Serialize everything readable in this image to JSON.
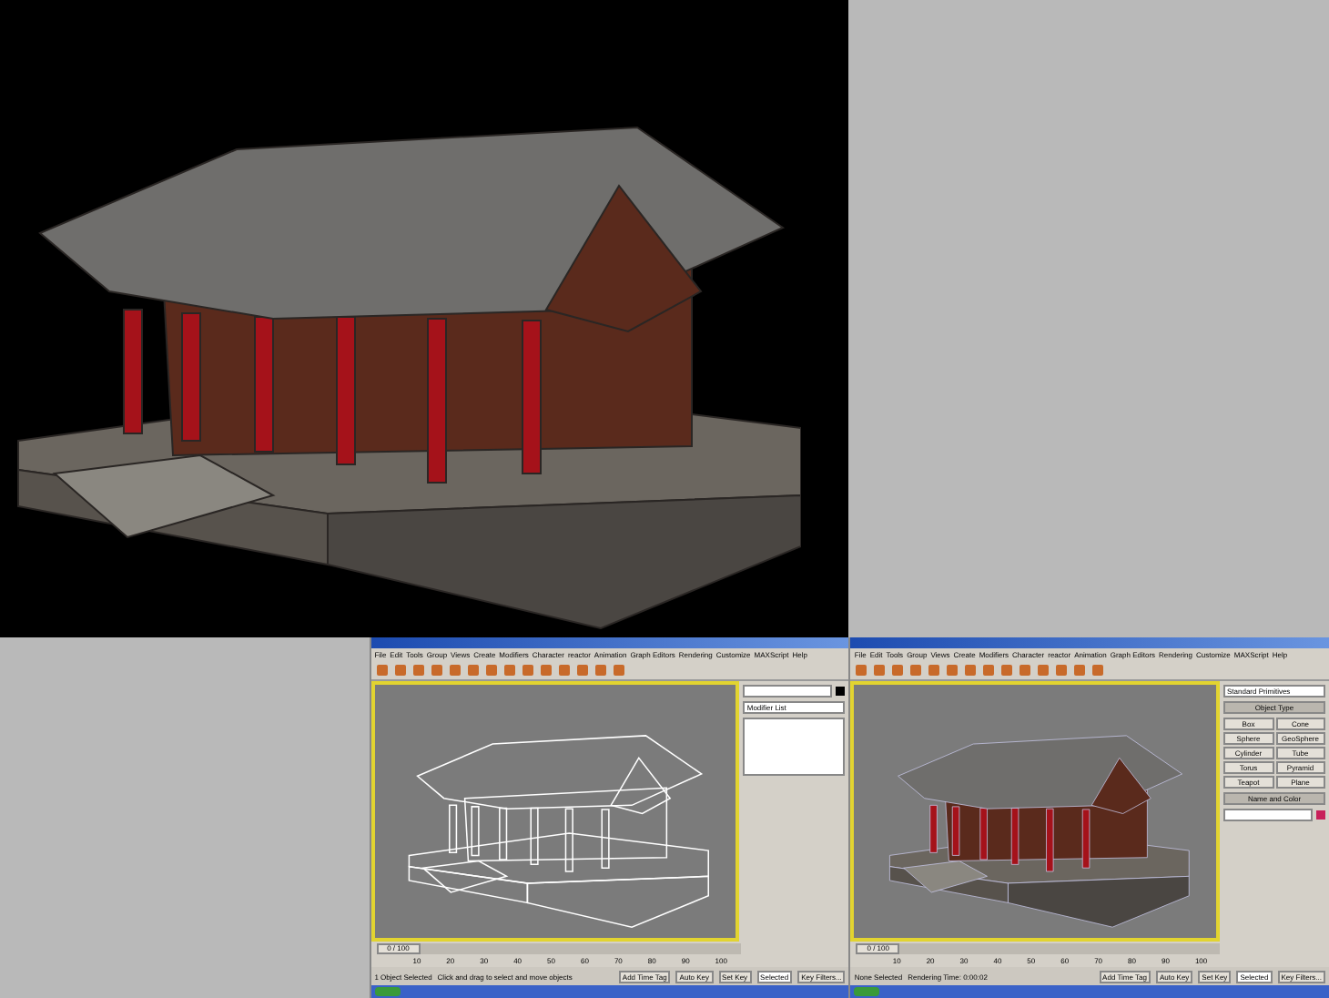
{
  "screenshots": [
    {
      "viewport": {
        "kind": "wireframe"
      },
      "menus": [
        "File",
        "Edit",
        "Tools",
        "Group",
        "Views",
        "Create",
        "Modifiers",
        "Character",
        "reactor",
        "Animation",
        "Graph Editors",
        "Rendering",
        "Customize",
        "MAXScript",
        "Help"
      ],
      "panel": {
        "kind": "modify",
        "dropdown": "Modifier List"
      },
      "timeline": {
        "position": "0 / 100",
        "level": 0,
        "ticks": [
          "10",
          "20",
          "30",
          "40",
          "50",
          "60",
          "70",
          "80",
          "90",
          "100"
        ]
      },
      "status": {
        "selection": "1 Object Selected",
        "prompt": "Click and drag to select and move objects",
        "auto_key": "Auto Key",
        "set_key": "Set Key",
        "key_mode": "Selected",
        "key_filters": "Key Filters...",
        "time_tag": "Add Time Tag"
      }
    },
    {
      "viewport": {
        "kind": "shaded"
      },
      "menus": [
        "File",
        "Edit",
        "Tools",
        "Group",
        "Views",
        "Create",
        "Modifiers",
        "Character",
        "reactor",
        "Animation",
        "Graph Editors",
        "Rendering",
        "Customize",
        "MAXScript",
        "Help"
      ],
      "panel": {
        "kind": "create",
        "dropdown": "Standard Primitives",
        "section": "Object Type",
        "buttons": [
          "Box",
          "Cone",
          "Sphere",
          "GeoSphere",
          "Cylinder",
          "Tube",
          "Torus",
          "Pyramid",
          "Teapot",
          "Plane"
        ],
        "section_2": "Name and Color"
      },
      "timeline": {
        "position": "0 / 100",
        "level": 0,
        "ticks": [
          "10",
          "20",
          "30",
          "40",
          "50",
          "60",
          "70",
          "80",
          "90",
          "100"
        ]
      },
      "status": {
        "selection": "None Selected",
        "prompt": "Rendering Time: 0:00:02",
        "auto_key": "Auto Key",
        "set_key": "Set Key",
        "key_mode": "Selected",
        "key_filters": "Key Filters...",
        "time_tag": "Add Time Tag"
      }
    }
  ]
}
